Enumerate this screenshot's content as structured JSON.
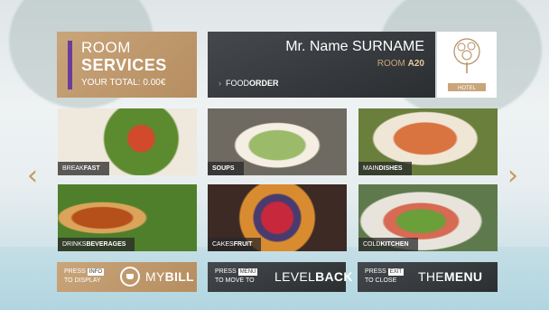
{
  "header": {
    "title_line1": "ROOM",
    "title_line2": "SERVICES",
    "total_label": "YOUR TOTAL: 0.00€"
  },
  "guest": {
    "name": "Mr. Name SURNAME",
    "room_label": "ROOM",
    "room_number": "A20",
    "breadcrumb_a": "FOOD",
    "breadcrumb_b": "ORDER"
  },
  "logo": {
    "text": "HOTEL"
  },
  "tiles": [
    {
      "a": "BREAK",
      "b": "FAST"
    },
    {
      "a": "",
      "b": "SOUPS"
    },
    {
      "a": "MAIN",
      "b": "DISHES"
    },
    {
      "a": "DRINKS",
      "b": "BEVERAGES"
    },
    {
      "a": "CAKES",
      "b": "FRUIT"
    },
    {
      "a": "COLD",
      "b": "KITCHEN"
    }
  ],
  "buttons": {
    "bill": {
      "press": "PRESS",
      "key": "INFO",
      "sub": "TO DISPLAY",
      "a": "MY",
      "b": "BILL"
    },
    "back": {
      "press": "PRESS",
      "key": "MENU",
      "sub": "TO MOVE TO",
      "a": "LEVEL",
      "b": "BACK"
    },
    "menu": {
      "press": "PRESS",
      "key": "EXIT",
      "sub": "TO CLOSE",
      "a": "THE",
      "b": "MENU"
    }
  },
  "colors": {
    "gold": "#c9a57a",
    "dark": "#2b2e31",
    "accent_bar": "#6b3d9a"
  },
  "icons": {
    "prev": "chevron-left-icon",
    "next": "chevron-right-icon",
    "bill": "cup-icon"
  }
}
